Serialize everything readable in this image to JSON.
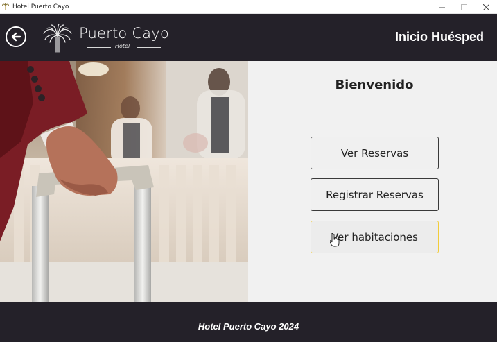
{
  "window": {
    "title": "Hotel Puerto Cayo",
    "icon": "palm-tree-icon",
    "controls": [
      "minimize-icon",
      "maximize-icon",
      "close-icon"
    ]
  },
  "header": {
    "back_icon": "arrow-left-circle-icon",
    "logo_name": "Puerto Cayo",
    "logo_sub": "Hotel",
    "logo_icon": "palm-tree-logo-icon",
    "page_title": "Inicio Huésped"
  },
  "main": {
    "welcome": "Bienvenido",
    "buttons": [
      {
        "label": "Ver Reservas"
      },
      {
        "label": "Registrar Reservas"
      },
      {
        "label": "Ver habitaciones"
      }
    ]
  },
  "footer": {
    "text": "Hotel Puerto Cayo 2024"
  },
  "colors": {
    "header_bg": "#242129",
    "panel_bg": "#f1f1f1",
    "button_border": "#3a3a3a",
    "button_hover_border": "#f2cc3a"
  }
}
